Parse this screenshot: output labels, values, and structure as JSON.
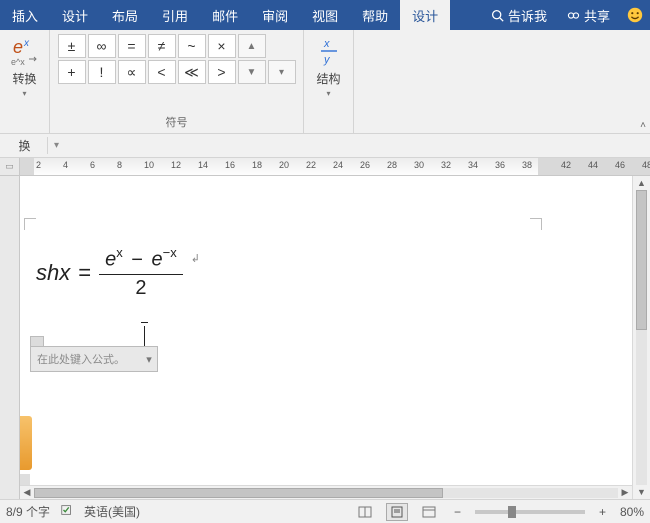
{
  "tabs": {
    "insert": "插入",
    "design": "设计",
    "layout": "布局",
    "references": "引用",
    "mailings": "邮件",
    "review": "审阅",
    "view": "视图",
    "help": "帮助",
    "eq_design": "设计"
  },
  "titlebar": {
    "tell_me": "告诉我",
    "share": "共享"
  },
  "ribbon": {
    "convert_label": "转换",
    "convert_group": "换",
    "symbols_group": "符号",
    "structures_label": "结构",
    "sym": {
      "pm": "±",
      "inf": "∞",
      "eq": "=",
      "neq": "≠",
      "tilde": "~",
      "mul": "×",
      "plus": "+",
      "excl": "!",
      "prop": "∝",
      "lt": "<",
      "ll": "≪",
      "gt": ">"
    }
  },
  "ruler": {
    "vals": [
      "2",
      "4",
      "6",
      "8",
      "10",
      "12",
      "14",
      "16",
      "18",
      "20",
      "22",
      "24",
      "26",
      "28",
      "30",
      "32",
      "34",
      "36",
      "38",
      "42",
      "44",
      "46",
      "48"
    ]
  },
  "equation": {
    "lhs": "shx",
    "eq": "=",
    "num_a": "e",
    "num_a_sup": "x",
    "minus": "−",
    "num_b": "e",
    "num_b_sup": "−x",
    "den": "2",
    "placeholder": "在此处键入公式。"
  },
  "status": {
    "page_words": "8/9 个字",
    "language": "英语(美国)",
    "zoom": "80%",
    "minus": "−",
    "plus": "+"
  }
}
